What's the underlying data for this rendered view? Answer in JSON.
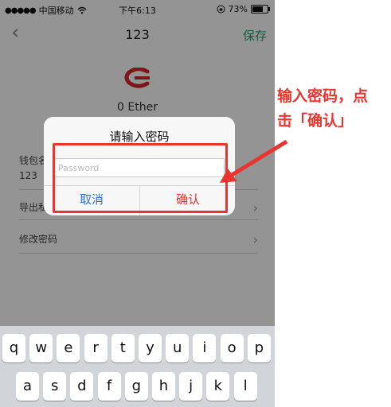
{
  "status_bar": {
    "carrier": "中国移动",
    "time": "下午6:13",
    "battery_percent": "73%",
    "battery_level": 0.73,
    "icons": [
      "signal-dots-icon",
      "wifi-icon",
      "lock-rotation-icon",
      "battery-icon"
    ]
  },
  "nav": {
    "back_icon": "chevron-left-icon",
    "title": "123",
    "save_label": "保存"
  },
  "wallet": {
    "logo_icon": "wallet-logo-icon",
    "balance": "0 Ether"
  },
  "rows": [
    {
      "label": "钱包名",
      "value": "123"
    },
    {
      "label": "导出私",
      "arrow": "chevron-right-icon"
    },
    {
      "label": "修改密码",
      "arrow": "chevron-right-icon"
    }
  ],
  "dialog": {
    "title": "请输入密码",
    "password_placeholder": "Password",
    "password_value": "",
    "cancel_label": "取消",
    "confirm_label": "确认"
  },
  "keyboard": {
    "row1": [
      "q",
      "w",
      "e",
      "r",
      "t",
      "y",
      "u",
      "i",
      "o",
      "p"
    ],
    "row2": [
      "a",
      "s",
      "d",
      "f",
      "g",
      "h",
      "j",
      "k",
      "l"
    ]
  },
  "annotation": {
    "line1": "输入密码，点",
    "line2": "击「确认」"
  },
  "colors": {
    "accent_green": "#2b9c6c",
    "cancel_blue": "#2a74d6",
    "confirm_red": "#e0322e",
    "highlight_red": "#e8352f"
  }
}
